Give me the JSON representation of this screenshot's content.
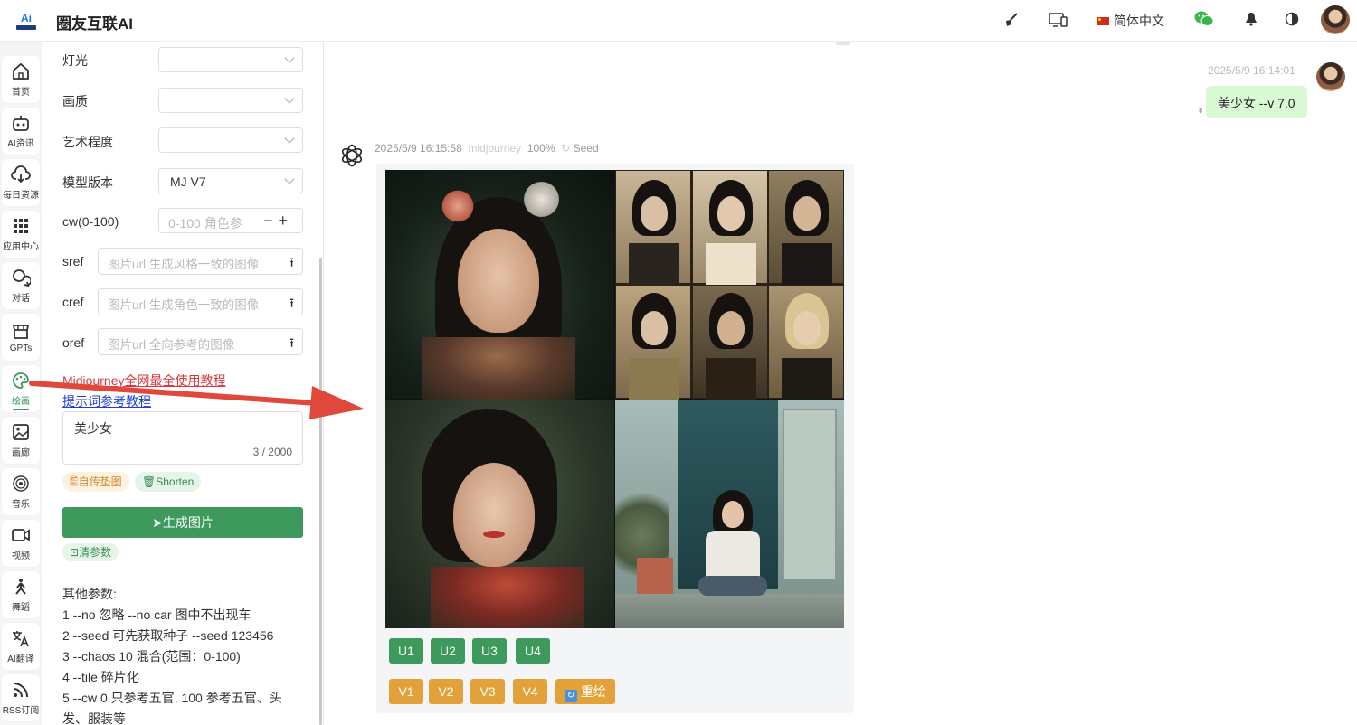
{
  "app": {
    "title": "圈友互联AI",
    "logo_text": "Ai"
  },
  "topbar": {
    "language": "简体中文"
  },
  "sidebar": {
    "items": [
      {
        "label": "首页",
        "icon": "home-icon"
      },
      {
        "label": "AI资讯",
        "icon": "robot-icon"
      },
      {
        "label": "每日资源",
        "icon": "cloud-download-icon"
      },
      {
        "label": "应用中心",
        "icon": "grid-icon"
      },
      {
        "label": "对话",
        "icon": "chat-icon"
      },
      {
        "label": "GPTs",
        "icon": "store-icon"
      },
      {
        "label": "绘画",
        "icon": "palette-icon",
        "active": true
      },
      {
        "label": "画廊",
        "icon": "image-icon"
      },
      {
        "label": "音乐",
        "icon": "music-icon"
      },
      {
        "label": "视频",
        "icon": "video-icon"
      },
      {
        "label": "舞蹈",
        "icon": "dance-icon"
      },
      {
        "label": "AI翻译",
        "icon": "translate-icon"
      },
      {
        "label": "RSS订阅",
        "icon": "rss-icon"
      }
    ]
  },
  "panel": {
    "light_label": "灯光",
    "quality_label": "画质",
    "art_label": "艺术程度",
    "model_label": "模型版本",
    "model_value": "MJ V7",
    "cw_label": "cw(0-100)",
    "cw_placeholder": "0-100 角色参",
    "sref_label": "sref",
    "sref_placeholder": "图片url 生成风格一致的图像",
    "cref_label": "cref",
    "cref_placeholder": "图片url 生成角色一致的图像",
    "oref_label": "oref",
    "oref_placeholder": "图片url 全向参考的图像",
    "tutorial_link": "Midjourney全网最全使用教程",
    "prompt_link": "提示词参考教程",
    "prompt_value": "美少女",
    "prompt_count": "3 / 2000",
    "upload_chip": "自传垫图",
    "shorten_chip": "Shorten",
    "generate_button": "生成图片",
    "clear_chip": "清参数",
    "params_title": "其他参数:",
    "params": [
      "1 --no 忽略 --no car 图中不出现车",
      "2 --seed 可先获取种子 --seed 123456",
      "3 --chaos 10 混合(范围：0-100)",
      "4 --tile 碎片化",
      "5 --cw 0 只参考五官, 100 参考五官、头发、服装等"
    ]
  },
  "chat": {
    "user_time": "2025/5/9 16:14:01",
    "user_message": "美少女 --v 7.0",
    "bot_time": "2025/5/9 16:15:58",
    "bot_model": "midjourney",
    "bot_progress": "100%",
    "seed_label": "Seed",
    "upscale_buttons": [
      "U1",
      "U2",
      "U3",
      "U4"
    ],
    "variation_buttons": [
      "V1",
      "V2",
      "V3",
      "V4"
    ],
    "redraw_button": "重绘"
  },
  "colors": {
    "accent": "#3e9a5c",
    "variation": "#e3a13a",
    "annotation_arrow": "#e0483c"
  }
}
